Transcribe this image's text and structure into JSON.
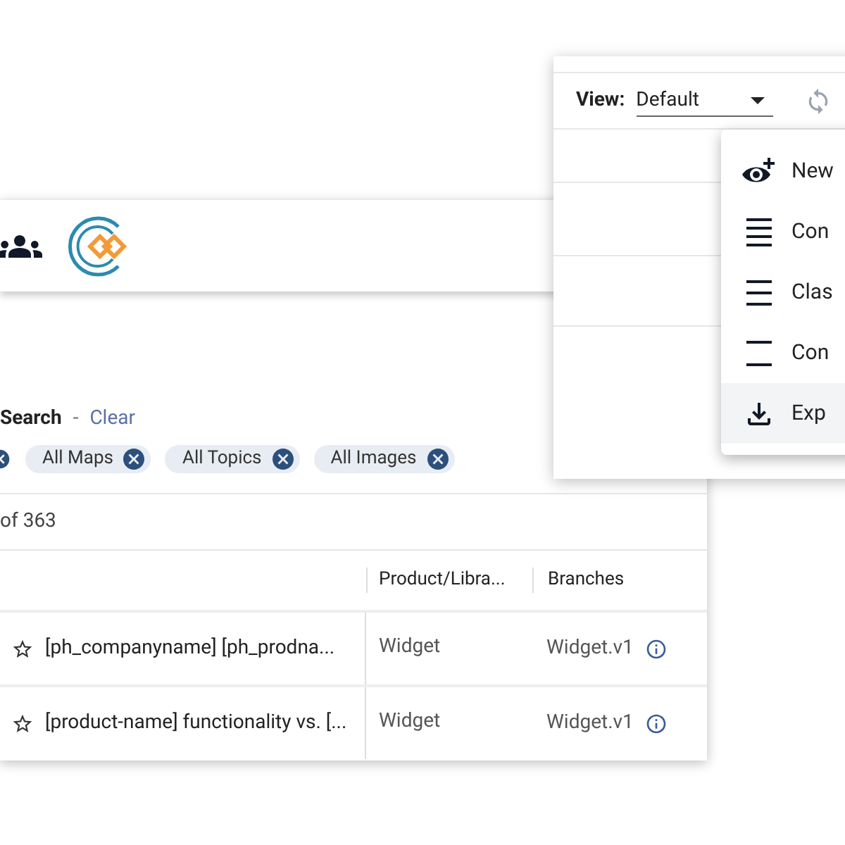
{
  "search": {
    "label": "Search",
    "separator": "-",
    "clear": "Clear"
  },
  "chips": [
    {
      "label": "All Maps"
    },
    {
      "label": "All Topics"
    },
    {
      "label": "All Images"
    }
  ],
  "count": "of 363",
  "table": {
    "columns": [
      {
        "label": "Product/Libra..."
      },
      {
        "label": "Branches"
      }
    ],
    "rows": [
      {
        "starred": false,
        "title": "[ph_companyname] [ph_prodna...",
        "product": "Widget",
        "branch": "Widget.v1"
      },
      {
        "starred": false,
        "title": "[product-name] functionality vs. [...",
        "product": "Widget",
        "branch": "Widget.v1"
      }
    ]
  },
  "view": {
    "label": "View:",
    "value": "Default"
  },
  "menu": [
    {
      "kind": "new",
      "label": "New",
      "highlighted": false
    },
    {
      "kind": "compact",
      "label": "Con",
      "highlighted": false
    },
    {
      "kind": "classic",
      "label": "Clas",
      "highlighted": false
    },
    {
      "kind": "comfortable",
      "label": "Con",
      "highlighted": false
    },
    {
      "kind": "export",
      "label": "Exp",
      "highlighted": true
    }
  ]
}
